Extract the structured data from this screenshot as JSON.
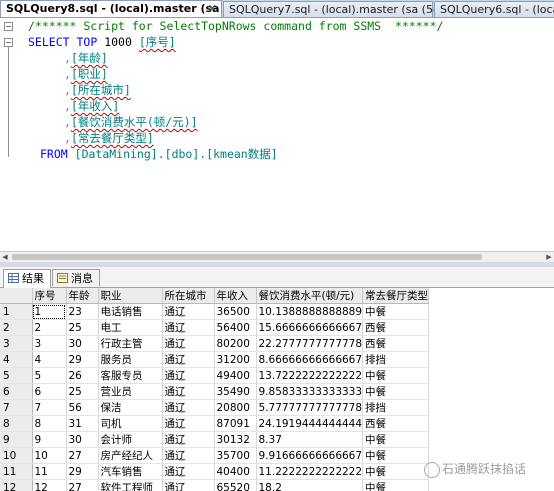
{
  "tabs": [
    {
      "label": "SQLQuery8.sql - (local).master (sa (66))",
      "active": true
    },
    {
      "label": "SQLQuery7.sql - (local).master (sa (54))",
      "active": false
    },
    {
      "label": "SQLQuery6.sql - (local)...",
      "active": false
    }
  ],
  "editor": {
    "comment": "/****** Script for SelectTopNRows command from SSMS  ******/",
    "select_kw": "SELECT",
    "top_kw": "TOP",
    "top_n": "1000",
    "columns": [
      "[序号]",
      "[年龄]",
      "[职业]",
      "[所在城市]",
      "[年收入]",
      "[餐饮消费水平(顿/元)]",
      "[常去餐厅类型]"
    ],
    "from_kw": "FROM",
    "table_ref": "[DataMining].[dbo].[kmean数据]"
  },
  "results": {
    "tab_results": "结果",
    "tab_messages": "消息",
    "columns": [
      "序号",
      "年龄",
      "职业",
      "所在城市",
      "年收入",
      "餐饮消费水平(顿/元)",
      "常去餐厅类型"
    ],
    "rows": [
      [
        "1",
        "1",
        "23",
        "电话销售",
        "通辽",
        "36500",
        "10.1388888888889",
        "中餐"
      ],
      [
        "2",
        "2",
        "25",
        "电工",
        "通辽",
        "56400",
        "15.6666666666667",
        "西餐"
      ],
      [
        "3",
        "3",
        "30",
        "行政主管",
        "通辽",
        "80200",
        "22.2777777777778",
        "西餐"
      ],
      [
        "4",
        "4",
        "29",
        "服务员",
        "通辽",
        "31200",
        "8.66666666666667",
        "排挡"
      ],
      [
        "5",
        "5",
        "26",
        "客服专员",
        "通辽",
        "49400",
        "13.7222222222222",
        "中餐"
      ],
      [
        "6",
        "6",
        "25",
        "营业员",
        "通辽",
        "35490",
        "9.85833333333333",
        "中餐"
      ],
      [
        "7",
        "7",
        "56",
        "保洁",
        "通辽",
        "20800",
        "5.77777777777778",
        "排挡"
      ],
      [
        "8",
        "8",
        "31",
        "司机",
        "通辽",
        "87091",
        "24.1919444444444",
        "西餐"
      ],
      [
        "9",
        "9",
        "30",
        "会计师",
        "通辽",
        "30132",
        "8.37",
        "中餐"
      ],
      [
        "10",
        "10",
        "27",
        "房产经纪人",
        "通辽",
        "35700",
        "9.91666666666667",
        "中餐"
      ],
      [
        "11",
        "11",
        "29",
        "汽车销售",
        "通辽",
        "40400",
        "11.2222222222222",
        "中餐"
      ],
      [
        "12",
        "12",
        "27",
        "软件工程师",
        "通辽",
        "65520",
        "18.2",
        "中餐"
      ]
    ]
  },
  "watermark": "石通腾跃抹掐话"
}
